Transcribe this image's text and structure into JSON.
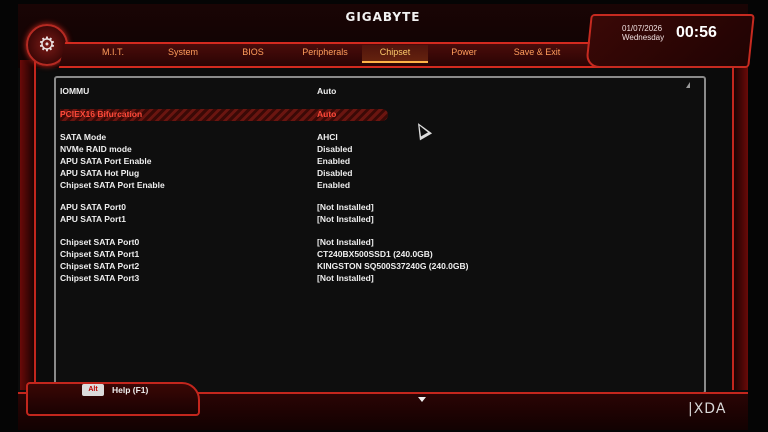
{
  "header": {
    "brand": "GIGABYTE",
    "tabs": [
      "M.I.T.",
      "System",
      "BIOS",
      "Peripherals",
      "Chipset",
      "Power",
      "Save & Exit"
    ],
    "active_tab": "Chipset",
    "date": "01/07/2026",
    "day": "Wednesday",
    "time": "00:56"
  },
  "settings": [
    {
      "label": "IOMMU",
      "value": "Auto"
    },
    {
      "label": "PCIEX16 Bifurcation",
      "value": "Auto",
      "selected": true
    },
    {
      "label": "SATA Mode",
      "value": "AHCI"
    },
    {
      "label": "NVMe RAID mode",
      "value": "Disabled"
    },
    {
      "label": "APU SATA Port Enable",
      "value": "Enabled"
    },
    {
      "label": "APU SATA Hot Plug",
      "value": "Disabled"
    },
    {
      "label": "Chipset SATA Port Enable",
      "value": "Enabled"
    },
    {
      "label": "APU SATA Port0",
      "value": "[Not Installed]"
    },
    {
      "label": "APU SATA Port1",
      "value": "[Not Installed]"
    },
    {
      "label": "Chipset SATA Port0",
      "value": "[Not Installed]"
    },
    {
      "label": "Chipset SATA Port1",
      "value": "CT240BX500SSD1 (240.0GB)"
    },
    {
      "label": "Chipset SATA Port2",
      "value": "KINGSTON SQ500S37240G (240.0GB)"
    },
    {
      "label": "Chipset SATA Port3",
      "value": "[Not Installed]"
    }
  ],
  "footer": {
    "alt_key": "Alt",
    "help_label": "Help (F1)"
  },
  "watermark": "|XDA",
  "colors": {
    "accent_red": "#d32a1f",
    "tab_text": "#ff9d5c",
    "active_tab": "#ffcb6b",
    "selected_text": "#ff4a3a"
  }
}
